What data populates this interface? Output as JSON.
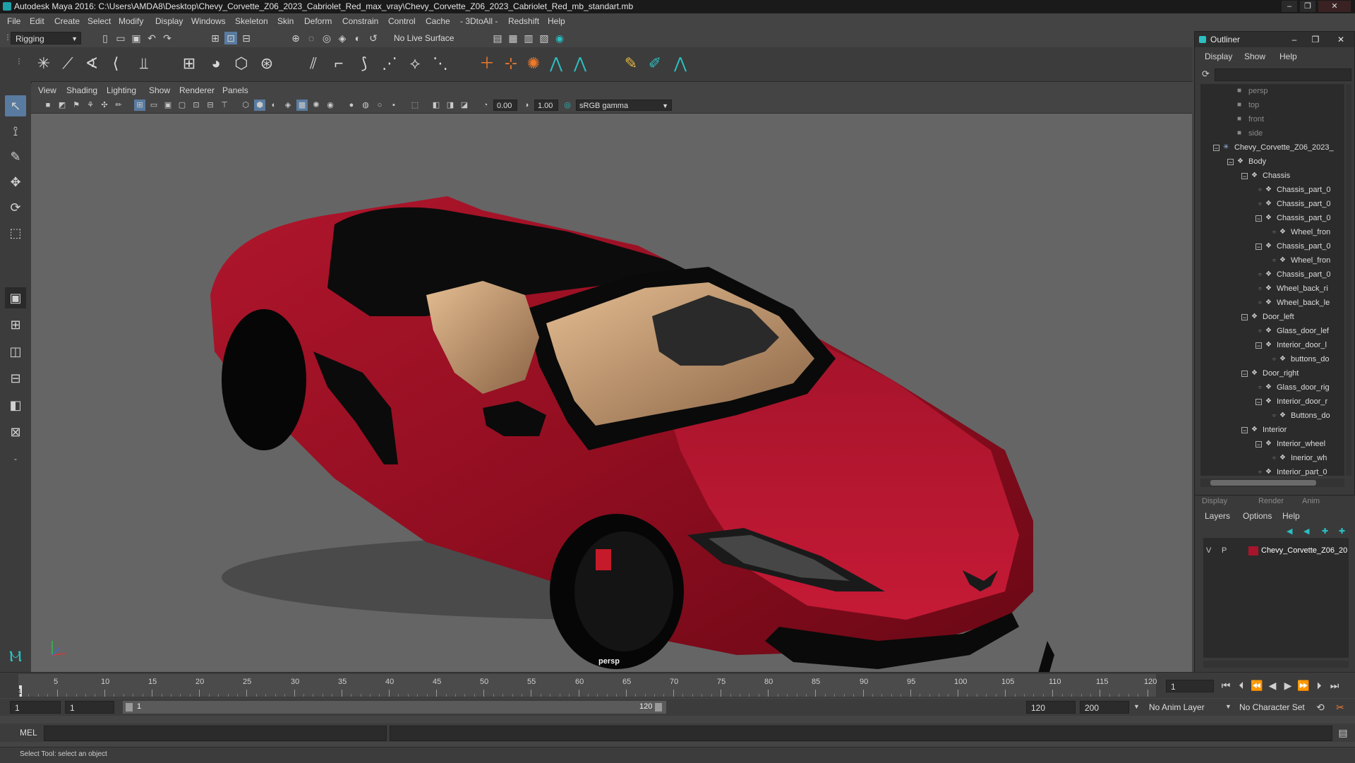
{
  "window": {
    "title": "Autodesk Maya 2016: C:\\Users\\AMDA8\\Desktop\\Chevy_Corvette_Z06_2023_Cabriolet_Red_max_vray\\Chevy_Corvette_Z06_2023_Cabriolet_Red_mb_standart.mb"
  },
  "menubar": [
    "File",
    "Edit",
    "Create",
    "Select",
    "Modify",
    "Display",
    "Windows",
    "Skeleton",
    "Skin",
    "Deform",
    "Constrain",
    "Control",
    "Cache",
    "- 3DtoAll -",
    "Redshift",
    "Help"
  ],
  "statusline": {
    "menu_set": "Rigging",
    "live_surface": "No Live Surface"
  },
  "viewport": {
    "menu": [
      "View",
      "Shading",
      "Lighting",
      "Show",
      "Renderer",
      "Panels"
    ],
    "exposure": "0.00",
    "gamma": "1.00",
    "color_space": "sRGB gamma",
    "camera_label": "persp"
  },
  "outliner": {
    "title": "Outliner",
    "menu": [
      "Display",
      "Show",
      "Help"
    ],
    "items": [
      {
        "label": "persp",
        "icon": "camera-icon",
        "dim": true
      },
      {
        "label": "top",
        "icon": "camera-icon",
        "dim": true
      },
      {
        "label": "front",
        "icon": "camera-icon",
        "dim": true
      },
      {
        "label": "side",
        "icon": "camera-icon",
        "dim": true
      },
      {
        "label": "Chevy_Corvette_Z06_2023_",
        "icon": "joint-icon",
        "expand": "-"
      },
      {
        "label": "Body",
        "icon": "group-icon",
        "expand": "-"
      },
      {
        "label": "Chassis",
        "icon": "group-icon",
        "expand": "-"
      },
      {
        "label": "Chassis_part_0",
        "icon": "group-icon"
      },
      {
        "label": "Chassis_part_0",
        "icon": "group-icon"
      },
      {
        "label": "Chassis_part_0",
        "icon": "group-icon",
        "expand": "-"
      },
      {
        "label": "Wheel_fron",
        "icon": "group-icon"
      },
      {
        "label": "Chassis_part_0",
        "icon": "group-icon",
        "expand": "-"
      },
      {
        "label": "Wheel_fron",
        "icon": "group-icon"
      },
      {
        "label": "Chassis_part_0",
        "icon": "group-icon"
      },
      {
        "label": "Wheel_back_ri",
        "icon": "group-icon"
      },
      {
        "label": "Wheel_back_le",
        "icon": "group-icon"
      },
      {
        "label": "Door_left",
        "icon": "group-icon",
        "expand": "-"
      },
      {
        "label": "Glass_door_lef",
        "icon": "group-icon"
      },
      {
        "label": "Interior_door_l",
        "icon": "group-icon",
        "expand": "-"
      },
      {
        "label": "buttons_do",
        "icon": "group-icon"
      },
      {
        "label": "Door_right",
        "icon": "group-icon",
        "expand": "-"
      },
      {
        "label": "Glass_door_rig",
        "icon": "group-icon"
      },
      {
        "label": "Interior_door_r",
        "icon": "group-icon",
        "expand": "-"
      },
      {
        "label": "Buttons_do",
        "icon": "group-icon"
      },
      {
        "label": "Interior",
        "icon": "group-icon",
        "expand": "-"
      },
      {
        "label": "Interior_wheel",
        "icon": "group-icon",
        "expand": "-"
      },
      {
        "label": "Inerior_wh",
        "icon": "group-icon"
      },
      {
        "label": "Interior_part_0",
        "icon": "group-icon"
      }
    ]
  },
  "layers": {
    "tabs": [
      "Display",
      "Render",
      "Anim"
    ],
    "menu": [
      "Layers",
      "Options",
      "Help"
    ],
    "layer": {
      "v": "V",
      "p": "P",
      "name": "Chevy_Corvette_Z06_20",
      "color": "#a8142c"
    }
  },
  "timeline": {
    "ticks": [
      "5",
      "10",
      "15",
      "20",
      "25",
      "30",
      "35",
      "40",
      "45",
      "50",
      "55",
      "60",
      "65",
      "70",
      "75",
      "80",
      "85",
      "90",
      "95",
      "100",
      "105",
      "110",
      "115",
      "120"
    ],
    "current_frame": "1",
    "current_marker": "1"
  },
  "range": {
    "start": "1",
    "playback_start": "1",
    "slider_start": "1",
    "slider_end": "120",
    "playback_end": "120",
    "end": "200",
    "anim_layer": "No Anim Layer",
    "char_set": "No Character Set"
  },
  "command": {
    "lang": "MEL"
  },
  "help": {
    "text": "Select Tool: select an object"
  },
  "colors": {
    "car_body": "#9b0f22",
    "interior": "#c49a70",
    "viewport_bg": "#656565"
  }
}
